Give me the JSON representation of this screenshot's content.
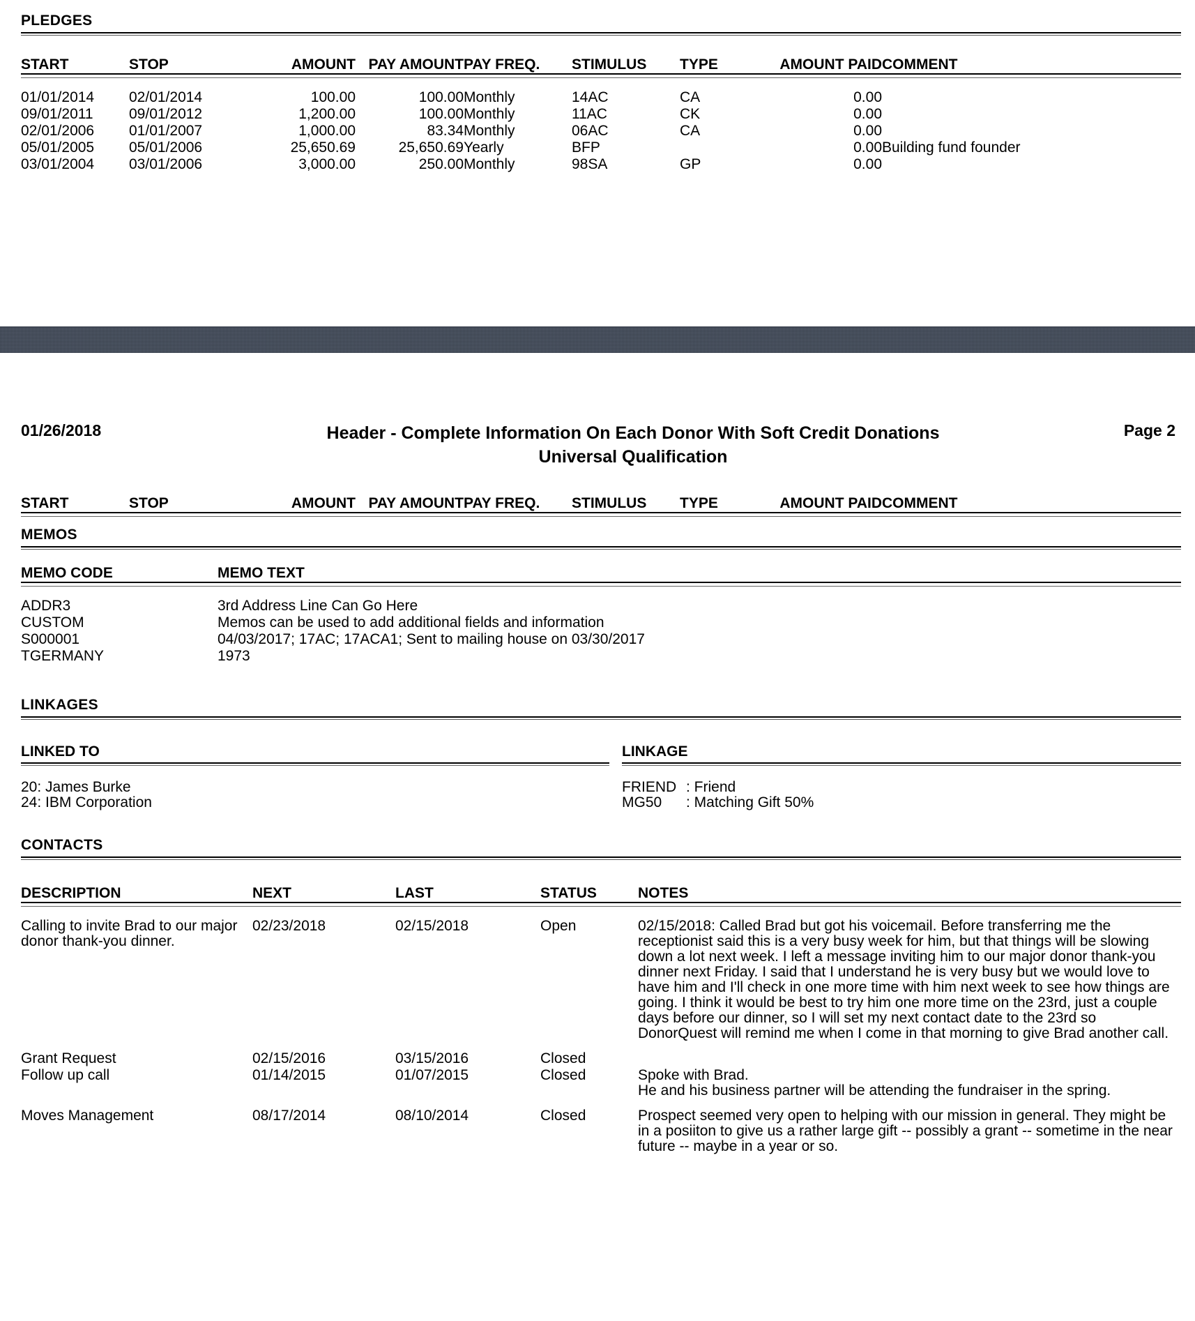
{
  "page1": {
    "pledges": {
      "section_label": "PLEDGES",
      "columns": [
        "START",
        "STOP",
        "AMOUNT",
        "PAY AMOUNT",
        "PAY FREQ.",
        "STIMULUS",
        "TYPE",
        "AMOUNT PAID",
        "COMMENT"
      ],
      "rows": [
        {
          "start": "01/01/2014",
          "stop": "02/01/2014",
          "amount": "100.00",
          "pay_amount": "100.00",
          "pay_freq": "Monthly",
          "stimulus": "14AC",
          "type": "CA",
          "amount_paid": "0.00",
          "comment": ""
        },
        {
          "start": "09/01/2011",
          "stop": "09/01/2012",
          "amount": "1,200.00",
          "pay_amount": "100.00",
          "pay_freq": "Monthly",
          "stimulus": "11AC",
          "type": "CK",
          "amount_paid": "0.00",
          "comment": ""
        },
        {
          "start": "02/01/2006",
          "stop": "01/01/2007",
          "amount": "1,000.00",
          "pay_amount": "83.34",
          "pay_freq": "Monthly",
          "stimulus": "06AC",
          "type": "CA",
          "amount_paid": "0.00",
          "comment": ""
        },
        {
          "start": "05/01/2005",
          "stop": "05/01/2006",
          "amount": "25,650.69",
          "pay_amount": "25,650.69",
          "pay_freq": "Yearly",
          "stimulus": "BFP",
          "type": "",
          "amount_paid": "0.00",
          "comment": "Building fund founder"
        },
        {
          "start": "03/01/2004",
          "stop": "03/01/2006",
          "amount": "3,000.00",
          "pay_amount": "250.00",
          "pay_freq": "Monthly",
          "stimulus": "98SA",
          "type": "GP",
          "amount_paid": "0.00",
          "comment": ""
        }
      ]
    }
  },
  "page2": {
    "header": {
      "date": "01/26/2018",
      "title_line1": "Header - Complete Information On Each Donor With Soft Credit Donations",
      "title_line2": "Universal Qualification",
      "page_label": "Page 2"
    },
    "pledges_header": {
      "columns": [
        "START",
        "STOP",
        "AMOUNT",
        "PAY AMOUNT",
        "PAY FREQ.",
        "STIMULUS",
        "TYPE",
        "AMOUNT PAID",
        "COMMENT"
      ]
    },
    "memos": {
      "section_label": "MEMOS",
      "columns": [
        "MEMO CODE",
        "MEMO TEXT"
      ],
      "rows": [
        {
          "code": "ADDR3",
          "text": "3rd Address Line Can Go Here"
        },
        {
          "code": "CUSTOM",
          "text": "Memos can be used to add additional fields and information"
        },
        {
          "code": "S000001",
          "text": "04/03/2017; 17AC; 17ACA1; Sent to mailing house on 03/30/2017"
        },
        {
          "code": "TGERMANY",
          "text": "1973"
        }
      ]
    },
    "linkages": {
      "section_label": "LINKAGES",
      "linked_to_header": "LINKED TO",
      "linkage_header": "LINKAGE",
      "linked_to": [
        "20: James Burke",
        "24: IBM Corporation"
      ],
      "linkage": [
        {
          "code": "FRIEND",
          "desc": ": Friend"
        },
        {
          "code": "MG50",
          "desc": ": Matching Gift 50%"
        }
      ]
    },
    "contacts": {
      "section_label": "CONTACTS",
      "columns": [
        "DESCRIPTION",
        "NEXT",
        "LAST",
        "STATUS",
        "NOTES"
      ],
      "rows": [
        {
          "description": "Calling to invite Brad to our major donor thank-you dinner.",
          "next": "02/23/2018",
          "last": "02/15/2018",
          "status": "Open",
          "notes": "02/15/2018: Called Brad but got his voicemail. Before transferring me the receptionist said this is a very busy week for him, but that things will be slowing down a lot next week. I left a message inviting him to our major donor thank-you dinner next Friday. I said that I understand he is very busy but we would love to have him and I'll check in one more time with him next week to see how things are going. I think it would be best to try him one more time on the 23rd, just a couple days before our dinner, so I will set my next contact date to the 23rd so DonorQuest will remind me when I come in that morning to give Brad another call."
        },
        {
          "description": "Grant Request",
          "next": "02/15/2016",
          "last": "03/15/2016",
          "status": "Closed",
          "notes": ""
        },
        {
          "description": "Follow up call",
          "next": "01/14/2015",
          "last": "01/07/2015",
          "status": "Closed",
          "notes": "Spoke with Brad.\nHe and his business partner will be attending the fundraiser in the spring."
        },
        {
          "description": "Moves Management",
          "next": "08/17/2014",
          "last": "08/10/2014",
          "status": "Closed",
          "notes": "Prospect seemed very open to helping with our mission in general. They might be in a posiiton to give us a rather large gift -- possibly a grant -- sometime in the near future -- maybe in a year or so."
        }
      ]
    }
  }
}
